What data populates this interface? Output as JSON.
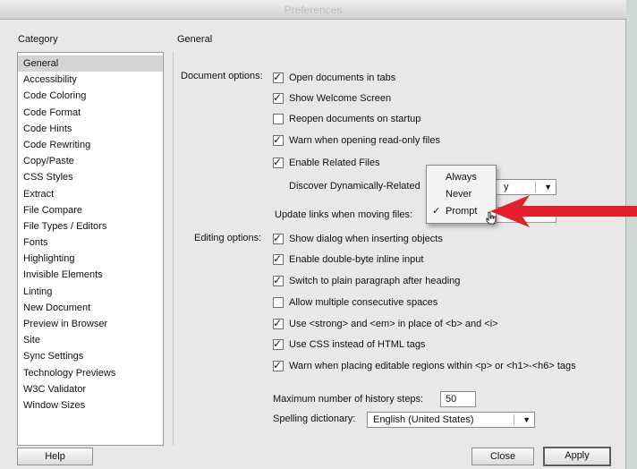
{
  "window": {
    "title": "Preferences"
  },
  "category_heading": "Category",
  "panel_heading": "General",
  "categories": [
    "General",
    "Accessibility",
    "Code Coloring",
    "Code Format",
    "Code Hints",
    "Code Rewriting",
    "Copy/Paste",
    "CSS Styles",
    "Extract",
    "File Compare",
    "File Types / Editors",
    "Fonts",
    "Highlighting",
    "Invisible Elements",
    "Linting",
    "New Document",
    "Preview in Browser",
    "Site",
    "Sync Settings",
    "Technology Previews",
    "W3C Validator",
    "Window Sizes"
  ],
  "selected_category": "General",
  "document_options": {
    "label": "Document options:",
    "items": [
      {
        "label": "Open documents in tabs",
        "checked": true
      },
      {
        "label": "Show Welcome Screen",
        "checked": true
      },
      {
        "label": "Reopen documents on startup",
        "checked": false
      },
      {
        "label": "Warn when opening read-only files",
        "checked": true
      },
      {
        "label": "Enable Related Files",
        "checked": true
      }
    ],
    "discover_label": "Discover Dynamically-Related",
    "discover_value_tail": "y",
    "update_links_label": "Update links when moving files:"
  },
  "update_links_popup": {
    "options": [
      "Always",
      "Never",
      "Prompt"
    ],
    "selected": "Prompt",
    "check_mark": "✓"
  },
  "editing_options": {
    "label": "Editing options:",
    "items": [
      {
        "label": "Show dialog when inserting objects",
        "checked": true
      },
      {
        "label": "Enable double-byte inline input",
        "checked": true
      },
      {
        "label": "Switch to plain paragraph after heading",
        "checked": true
      },
      {
        "label": "Allow multiple consecutive spaces",
        "checked": false
      },
      {
        "label": "Use <strong> and <em> in place of <b> and <i>",
        "checked": true
      },
      {
        "label": "Use CSS instead of HTML tags",
        "checked": true
      },
      {
        "label": "Warn when placing editable regions within <p> or <h1>-<h6> tags",
        "checked": true
      }
    ]
  },
  "history": {
    "label": "Maximum number of history steps:",
    "value": "50"
  },
  "spelling": {
    "label": "Spelling dictionary:",
    "value": "English (United States)"
  },
  "buttons": {
    "help": "Help",
    "close": "Close",
    "apply": "Apply"
  },
  "glyphs": {
    "check": "✓",
    "dropdown_arrow": "▼"
  },
  "colors": {
    "annotation_arrow": "#e3202a",
    "selected_row": "#d4d4d4"
  }
}
